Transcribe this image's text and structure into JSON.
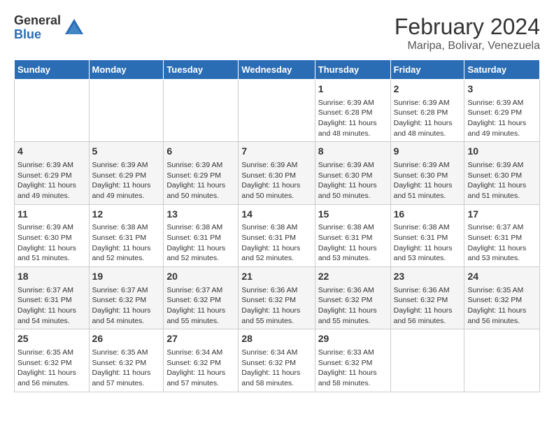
{
  "logo": {
    "general": "General",
    "blue": "Blue"
  },
  "title": "February 2024",
  "subtitle": "Maripa, Bolivar, Venezuela",
  "days": [
    "Sunday",
    "Monday",
    "Tuesday",
    "Wednesday",
    "Thursday",
    "Friday",
    "Saturday"
  ],
  "weeks": [
    [
      {
        "day": "",
        "info": ""
      },
      {
        "day": "",
        "info": ""
      },
      {
        "day": "",
        "info": ""
      },
      {
        "day": "",
        "info": ""
      },
      {
        "day": "1",
        "info": "Sunrise: 6:39 AM\nSunset: 6:28 PM\nDaylight: 11 hours and 48 minutes."
      },
      {
        "day": "2",
        "info": "Sunrise: 6:39 AM\nSunset: 6:28 PM\nDaylight: 11 hours and 48 minutes."
      },
      {
        "day": "3",
        "info": "Sunrise: 6:39 AM\nSunset: 6:29 PM\nDaylight: 11 hours and 49 minutes."
      }
    ],
    [
      {
        "day": "4",
        "info": "Sunrise: 6:39 AM\nSunset: 6:29 PM\nDaylight: 11 hours and 49 minutes."
      },
      {
        "day": "5",
        "info": "Sunrise: 6:39 AM\nSunset: 6:29 PM\nDaylight: 11 hours and 49 minutes."
      },
      {
        "day": "6",
        "info": "Sunrise: 6:39 AM\nSunset: 6:29 PM\nDaylight: 11 hours and 50 minutes."
      },
      {
        "day": "7",
        "info": "Sunrise: 6:39 AM\nSunset: 6:30 PM\nDaylight: 11 hours and 50 minutes."
      },
      {
        "day": "8",
        "info": "Sunrise: 6:39 AM\nSunset: 6:30 PM\nDaylight: 11 hours and 50 minutes."
      },
      {
        "day": "9",
        "info": "Sunrise: 6:39 AM\nSunset: 6:30 PM\nDaylight: 11 hours and 51 minutes."
      },
      {
        "day": "10",
        "info": "Sunrise: 6:39 AM\nSunset: 6:30 PM\nDaylight: 11 hours and 51 minutes."
      }
    ],
    [
      {
        "day": "11",
        "info": "Sunrise: 6:39 AM\nSunset: 6:30 PM\nDaylight: 11 hours and 51 minutes."
      },
      {
        "day": "12",
        "info": "Sunrise: 6:38 AM\nSunset: 6:31 PM\nDaylight: 11 hours and 52 minutes."
      },
      {
        "day": "13",
        "info": "Sunrise: 6:38 AM\nSunset: 6:31 PM\nDaylight: 11 hours and 52 minutes."
      },
      {
        "day": "14",
        "info": "Sunrise: 6:38 AM\nSunset: 6:31 PM\nDaylight: 11 hours and 52 minutes."
      },
      {
        "day": "15",
        "info": "Sunrise: 6:38 AM\nSunset: 6:31 PM\nDaylight: 11 hours and 53 minutes."
      },
      {
        "day": "16",
        "info": "Sunrise: 6:38 AM\nSunset: 6:31 PM\nDaylight: 11 hours and 53 minutes."
      },
      {
        "day": "17",
        "info": "Sunrise: 6:37 AM\nSunset: 6:31 PM\nDaylight: 11 hours and 53 minutes."
      }
    ],
    [
      {
        "day": "18",
        "info": "Sunrise: 6:37 AM\nSunset: 6:31 PM\nDaylight: 11 hours and 54 minutes."
      },
      {
        "day": "19",
        "info": "Sunrise: 6:37 AM\nSunset: 6:32 PM\nDaylight: 11 hours and 54 minutes."
      },
      {
        "day": "20",
        "info": "Sunrise: 6:37 AM\nSunset: 6:32 PM\nDaylight: 11 hours and 55 minutes."
      },
      {
        "day": "21",
        "info": "Sunrise: 6:36 AM\nSunset: 6:32 PM\nDaylight: 11 hours and 55 minutes."
      },
      {
        "day": "22",
        "info": "Sunrise: 6:36 AM\nSunset: 6:32 PM\nDaylight: 11 hours and 55 minutes."
      },
      {
        "day": "23",
        "info": "Sunrise: 6:36 AM\nSunset: 6:32 PM\nDaylight: 11 hours and 56 minutes."
      },
      {
        "day": "24",
        "info": "Sunrise: 6:35 AM\nSunset: 6:32 PM\nDaylight: 11 hours and 56 minutes."
      }
    ],
    [
      {
        "day": "25",
        "info": "Sunrise: 6:35 AM\nSunset: 6:32 PM\nDaylight: 11 hours and 56 minutes."
      },
      {
        "day": "26",
        "info": "Sunrise: 6:35 AM\nSunset: 6:32 PM\nDaylight: 11 hours and 57 minutes."
      },
      {
        "day": "27",
        "info": "Sunrise: 6:34 AM\nSunset: 6:32 PM\nDaylight: 11 hours and 57 minutes."
      },
      {
        "day": "28",
        "info": "Sunrise: 6:34 AM\nSunset: 6:32 PM\nDaylight: 11 hours and 58 minutes."
      },
      {
        "day": "29",
        "info": "Sunrise: 6:33 AM\nSunset: 6:32 PM\nDaylight: 11 hours and 58 minutes."
      },
      {
        "day": "",
        "info": ""
      },
      {
        "day": "",
        "info": ""
      }
    ]
  ]
}
